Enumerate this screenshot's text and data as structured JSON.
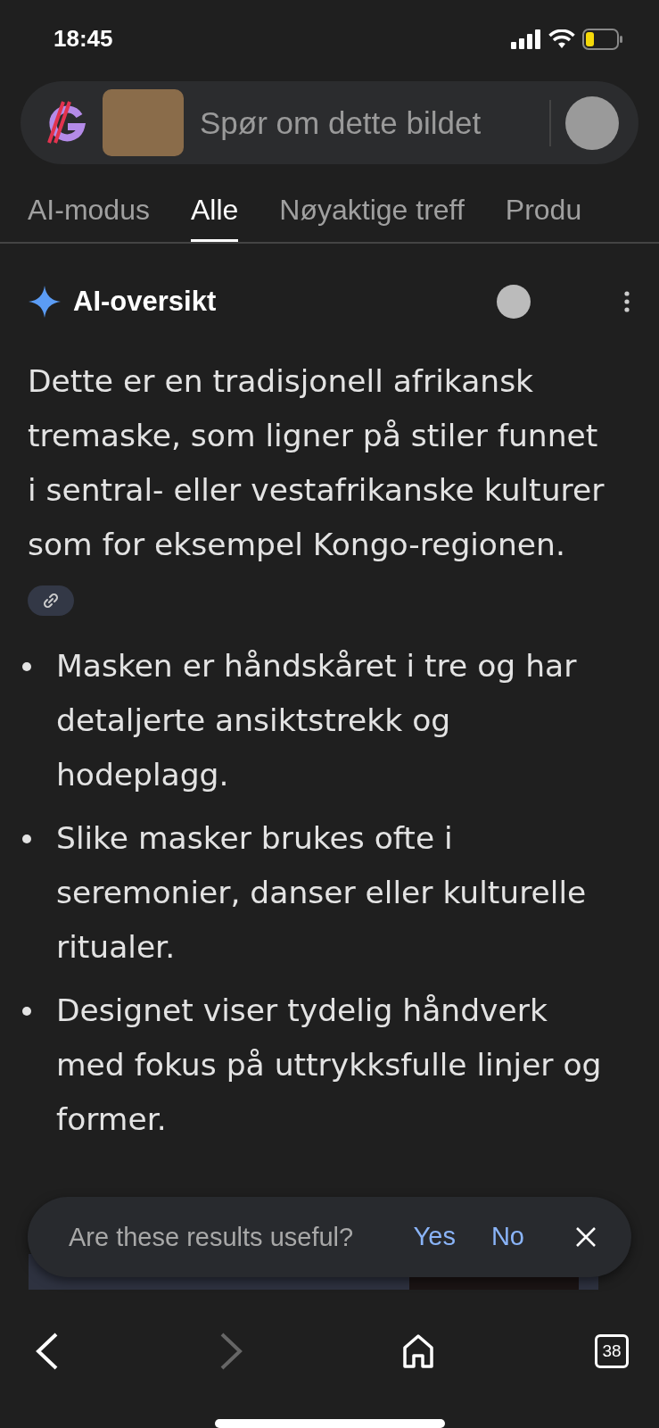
{
  "status_bar": {
    "time": "18:45"
  },
  "search_bar": {
    "placeholder": "Spør om dette bildet"
  },
  "tabs": [
    {
      "label": "AI-modus",
      "selected": false
    },
    {
      "label": "Alle",
      "selected": true
    },
    {
      "label": "Nøyaktige treff",
      "selected": false
    },
    {
      "label": "Produ",
      "selected": false
    }
  ],
  "ai_overview": {
    "title": "AI-oversikt",
    "summary": "Dette er en tradisjonell afrikansk tremaske, som ligner på stiler funnet i sentral- eller vestafrikanske kulturer som for eksempel Kongo-regionen.",
    "bullets": [
      "Masken er håndskåret i tre og har detaljerte ansiktstrekk og hodeplagg.",
      "Slike masker brukes ofte i seremonier, danser eller kulturelle ritualer.",
      "Designet viser tydelig håndverk med fokus på uttrykksfulle linjer og former."
    ]
  },
  "feedback_toast": {
    "question": "Are these results useful?",
    "yes": "Yes",
    "no": "No"
  },
  "bottom_nav": {
    "back_enabled": true,
    "forward_enabled": false,
    "tab_count": "38"
  }
}
